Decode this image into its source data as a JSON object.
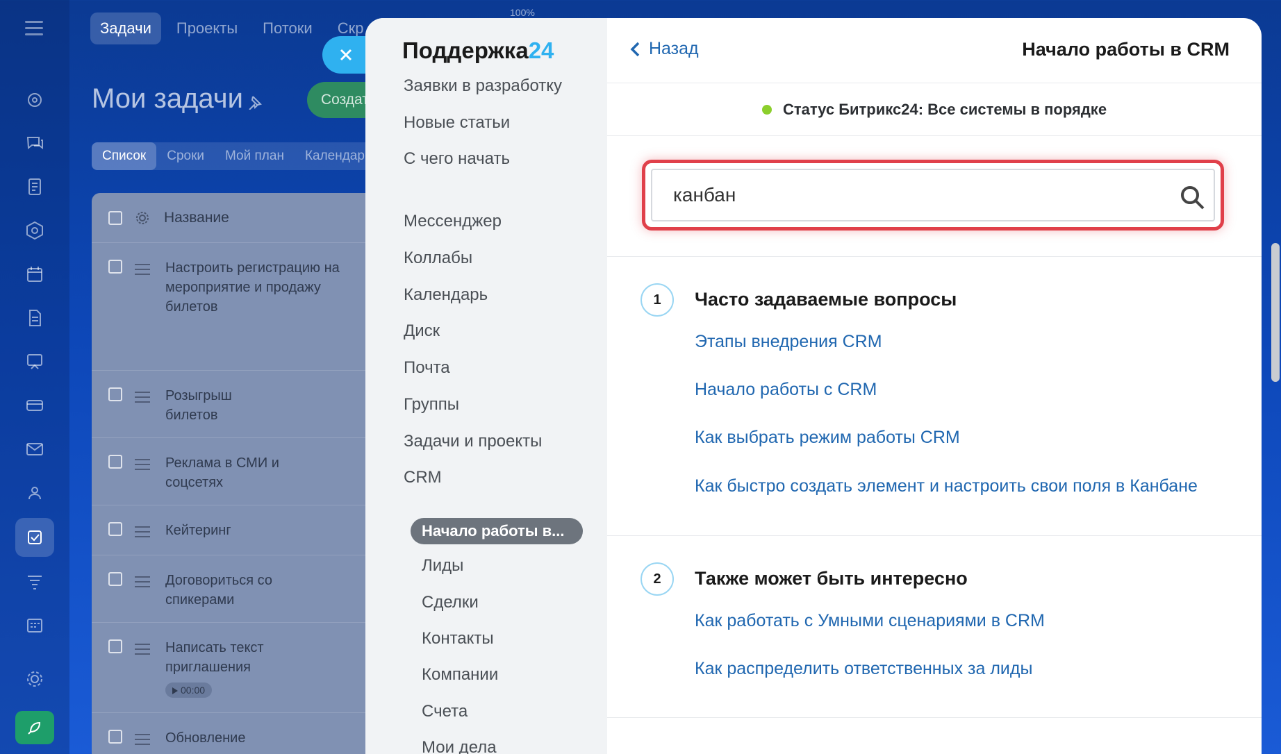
{
  "zoom": "100%",
  "top_nav": {
    "tabs": [
      {
        "label": "Задачи",
        "active": true
      },
      {
        "label": "Проекты",
        "active": false
      },
      {
        "label": "Потоки",
        "active": false
      },
      {
        "label": "Скр",
        "active": false
      }
    ]
  },
  "tasks_page": {
    "title": "Мои задачи",
    "create_label": "Создат",
    "view_tabs": [
      "Список",
      "Сроки",
      "Мой план",
      "Календар"
    ],
    "column_header": "Название",
    "rows": [
      {
        "title": "Настроить регистрацию на мероприятие и продажу билетов"
      },
      {
        "title": "Розыгрыш билетов"
      },
      {
        "title": "Реклама в СМИ и соцсетях"
      },
      {
        "title": "Кейтеринг"
      },
      {
        "title": "Договориться со спикерами"
      },
      {
        "title": "Написать текст приглашения",
        "timer": "00:00"
      },
      {
        "title": "Обновление оргтехники"
      }
    ]
  },
  "help_panel": {
    "brand_name": "Поддержка",
    "brand_number": "24",
    "nav_items": [
      "Заявки в разработку",
      "Новые статьи",
      "С чего начать",
      "Мессенджер",
      "Коллабы",
      "Календарь",
      "Диск",
      "Почта",
      "Группы",
      "Задачи и проекты",
      "CRM"
    ],
    "crm_active_item": "Начало работы в...",
    "crm_sub_items": [
      "Лиды",
      "Сделки",
      "Контакты",
      "Компании",
      "Счета",
      "Мои дела"
    ],
    "back_label": "Назад",
    "page_title": "Начало работы в CRM",
    "status_text": "Статус Битрикс24: Все системы в порядке",
    "status_color": "#8ccf2c",
    "search_value": "канбан",
    "search_highlight_color": "#e0404a",
    "sections": [
      {
        "number": "1",
        "title": "Часто задаваемые вопросы",
        "links": [
          "Этапы внедрения CRM",
          "Начало работы с CRM",
          "Как выбрать режим работы CRM",
          "Как быстро создать элемент и настроить свои поля в Канбане"
        ]
      },
      {
        "number": "2",
        "title": "Также может быть интересно",
        "links": [
          "Как работать с Умными сценариями в CRM",
          "Как распределить ответственных за лиды"
        ]
      }
    ]
  }
}
